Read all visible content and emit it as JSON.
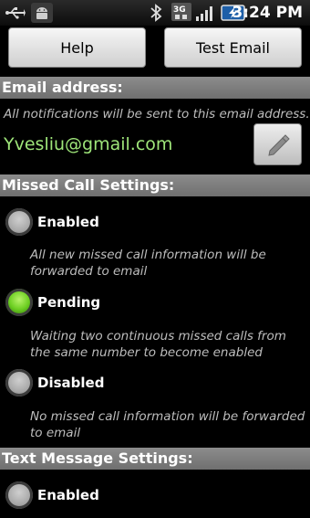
{
  "statusbar": {
    "time": "3:24 PM",
    "icons": [
      "usb-icon",
      "android-debug-icon",
      "bluetooth-icon",
      "3g-icon",
      "signal-icon",
      "battery-charging-icon"
    ]
  },
  "buttons": {
    "help": "Help",
    "test_email": "Test Email"
  },
  "email_section": {
    "header": "Email address:",
    "description": "All notifications will be sent to this email address.",
    "address": "Yvesliu@gmail.com",
    "edit_icon": "pencil-icon"
  },
  "missed_call_section": {
    "header": "Missed Call Settings:",
    "options": [
      {
        "label": "Enabled",
        "checked": false,
        "description": "All new missed call information will be forwarded to email"
      },
      {
        "label": "Pending",
        "checked": true,
        "description": "Waiting two continuous missed calls from the same number to become enabled"
      },
      {
        "label": "Disabled",
        "checked": false,
        "description": "No missed call information will be forwarded to email"
      }
    ]
  },
  "text_message_section": {
    "header": "Text Message Settings:",
    "options": [
      {
        "label": "Enabled",
        "checked": false
      }
    ]
  },
  "colors": {
    "email_text": "#9fe67a",
    "radio_checked": "#6dcf22",
    "section_header_bg": "#7c7c7c"
  }
}
